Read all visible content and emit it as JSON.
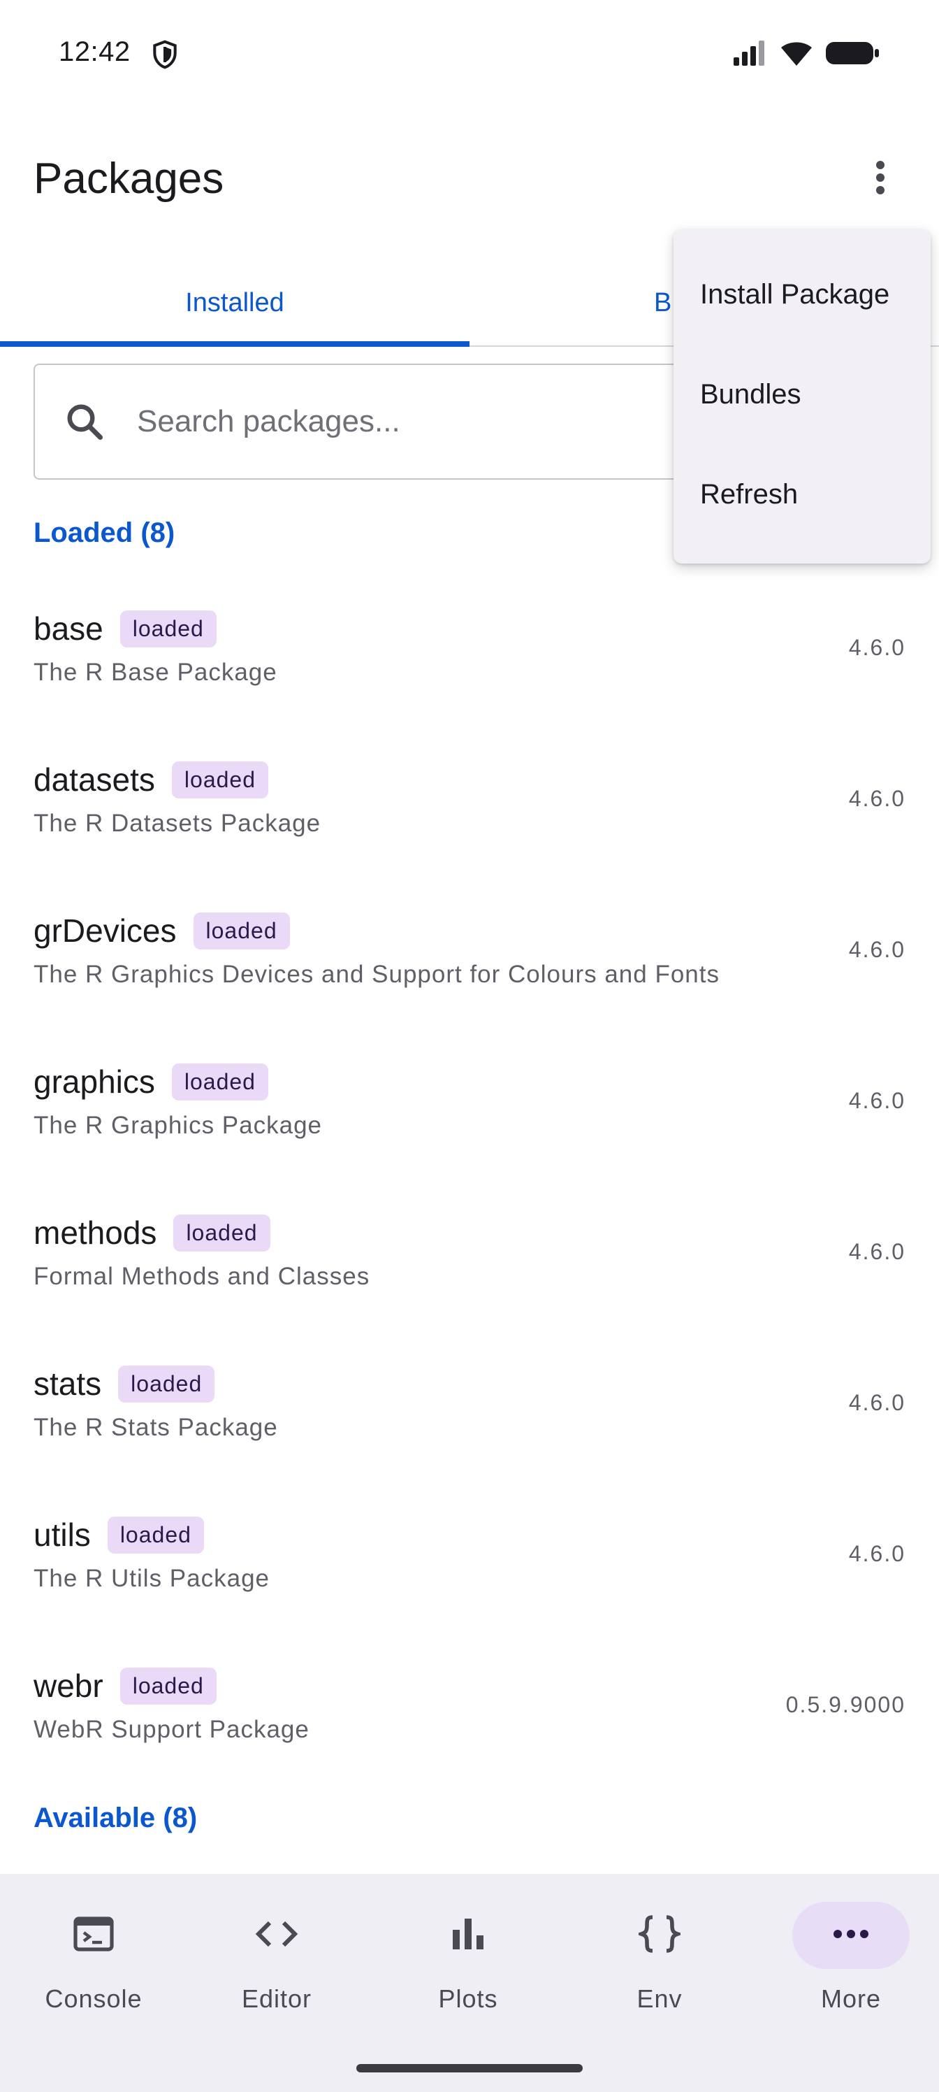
{
  "status": {
    "time": "12:42"
  },
  "app_bar": {
    "title": "Packages"
  },
  "tabs": [
    {
      "label": "Installed",
      "selected": true
    },
    {
      "label": "B",
      "selected": false
    }
  ],
  "search": {
    "placeholder": "Search packages..."
  },
  "sections": {
    "loaded_header": "Loaded (8)",
    "available_header": "Available (8)"
  },
  "packages": [
    {
      "name": "base",
      "badge": "loaded",
      "description": "The R Base Package",
      "version": "4.6.0"
    },
    {
      "name": "datasets",
      "badge": "loaded",
      "description": "The R Datasets Package",
      "version": "4.6.0"
    },
    {
      "name": "grDevices",
      "badge": "loaded",
      "description": "The R Graphics Devices and Support for Colours and Fonts",
      "version": "4.6.0"
    },
    {
      "name": "graphics",
      "badge": "loaded",
      "description": "The R Graphics Package",
      "version": "4.6.0"
    },
    {
      "name": "methods",
      "badge": "loaded",
      "description": "Formal Methods and Classes",
      "version": "4.6.0"
    },
    {
      "name": "stats",
      "badge": "loaded",
      "description": "The R Stats Package",
      "version": "4.6.0"
    },
    {
      "name": "utils",
      "badge": "loaded",
      "description": "The R Utils Package",
      "version": "4.6.0"
    },
    {
      "name": "webr",
      "badge": "loaded",
      "description": "WebR Support Package",
      "version": "0.5.9.9000"
    }
  ],
  "menu": {
    "items": [
      "Install Package",
      "Bundles",
      "Refresh"
    ]
  },
  "bottom_nav": [
    {
      "label": "Console",
      "icon": "console-icon"
    },
    {
      "label": "Editor",
      "icon": "code-icon"
    },
    {
      "label": "Plots",
      "icon": "bar-chart-icon"
    },
    {
      "label": "Env",
      "icon": "braces-icon"
    },
    {
      "label": "More",
      "icon": "more-horiz-icon",
      "active": true
    }
  ],
  "colors": {
    "accent": "#0b57d0",
    "badge_bg": "#ead9f7",
    "nav_bg": "#f0eef5",
    "menu_bg": "#f2f0f5"
  }
}
